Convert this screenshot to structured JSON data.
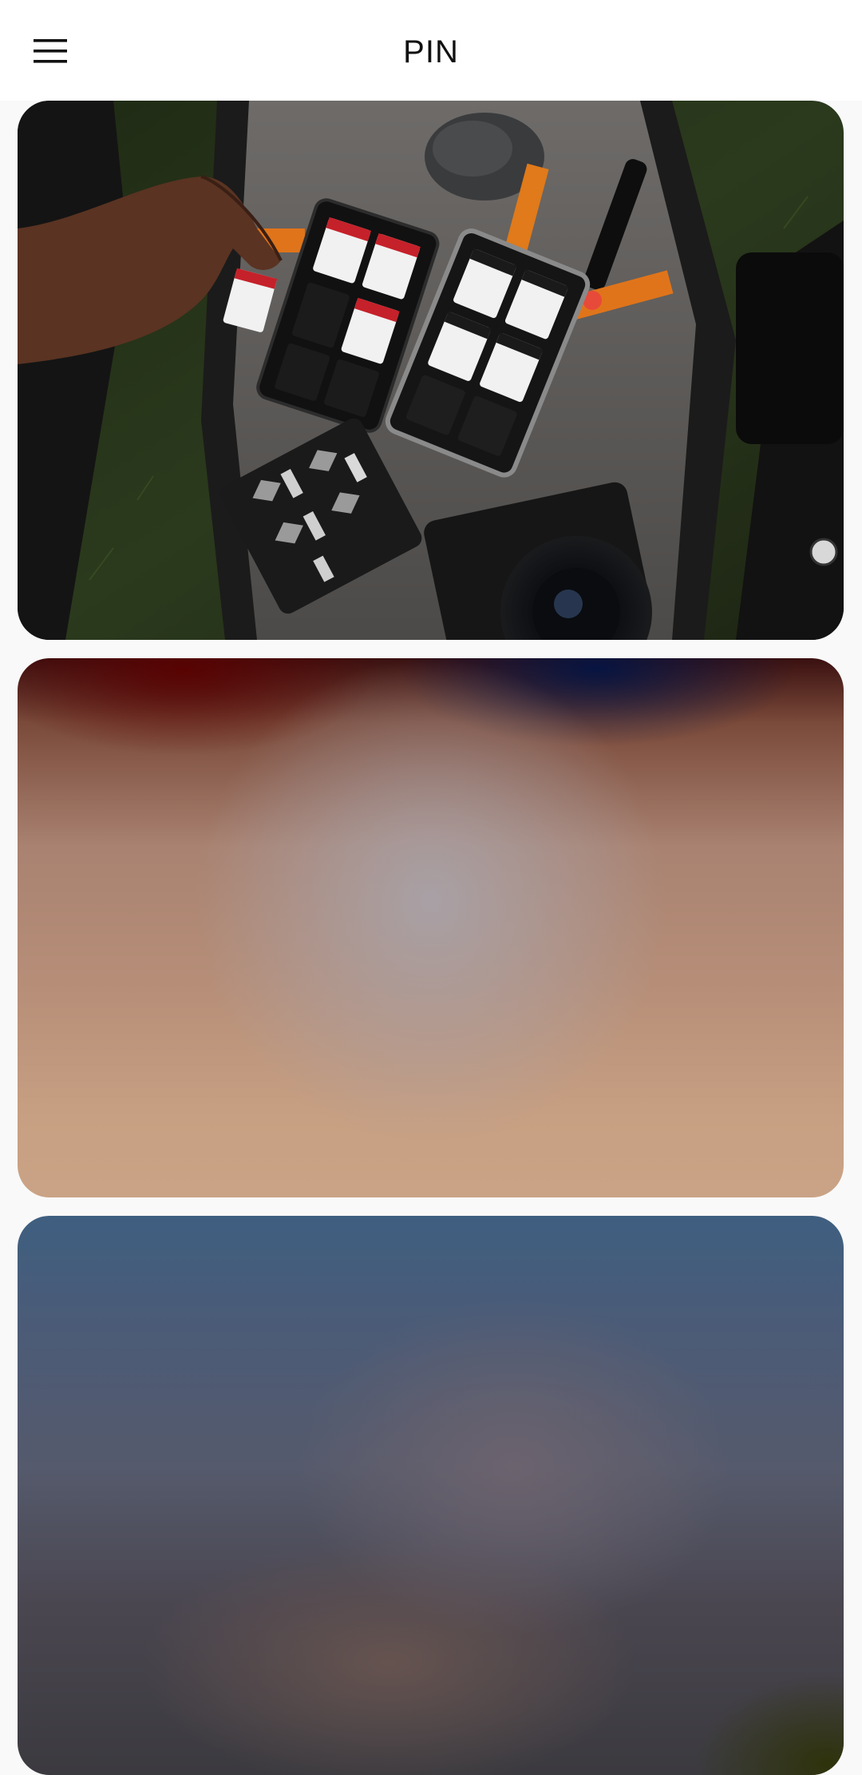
{
  "app_bar": {
    "title": "PIN",
    "menu_icon": "hamburger-menu-icon"
  },
  "feed": {
    "items": [
      {
        "kind": "photo",
        "subject": "camera-bag-with-sd-cards"
      },
      {
        "kind": "loading-placeholder"
      },
      {
        "kind": "loading-placeholder"
      }
    ]
  },
  "colors": {
    "app_bar_bg": "#ffffff",
    "page_bg": "#f9f9f9",
    "title_text": "#111111"
  }
}
